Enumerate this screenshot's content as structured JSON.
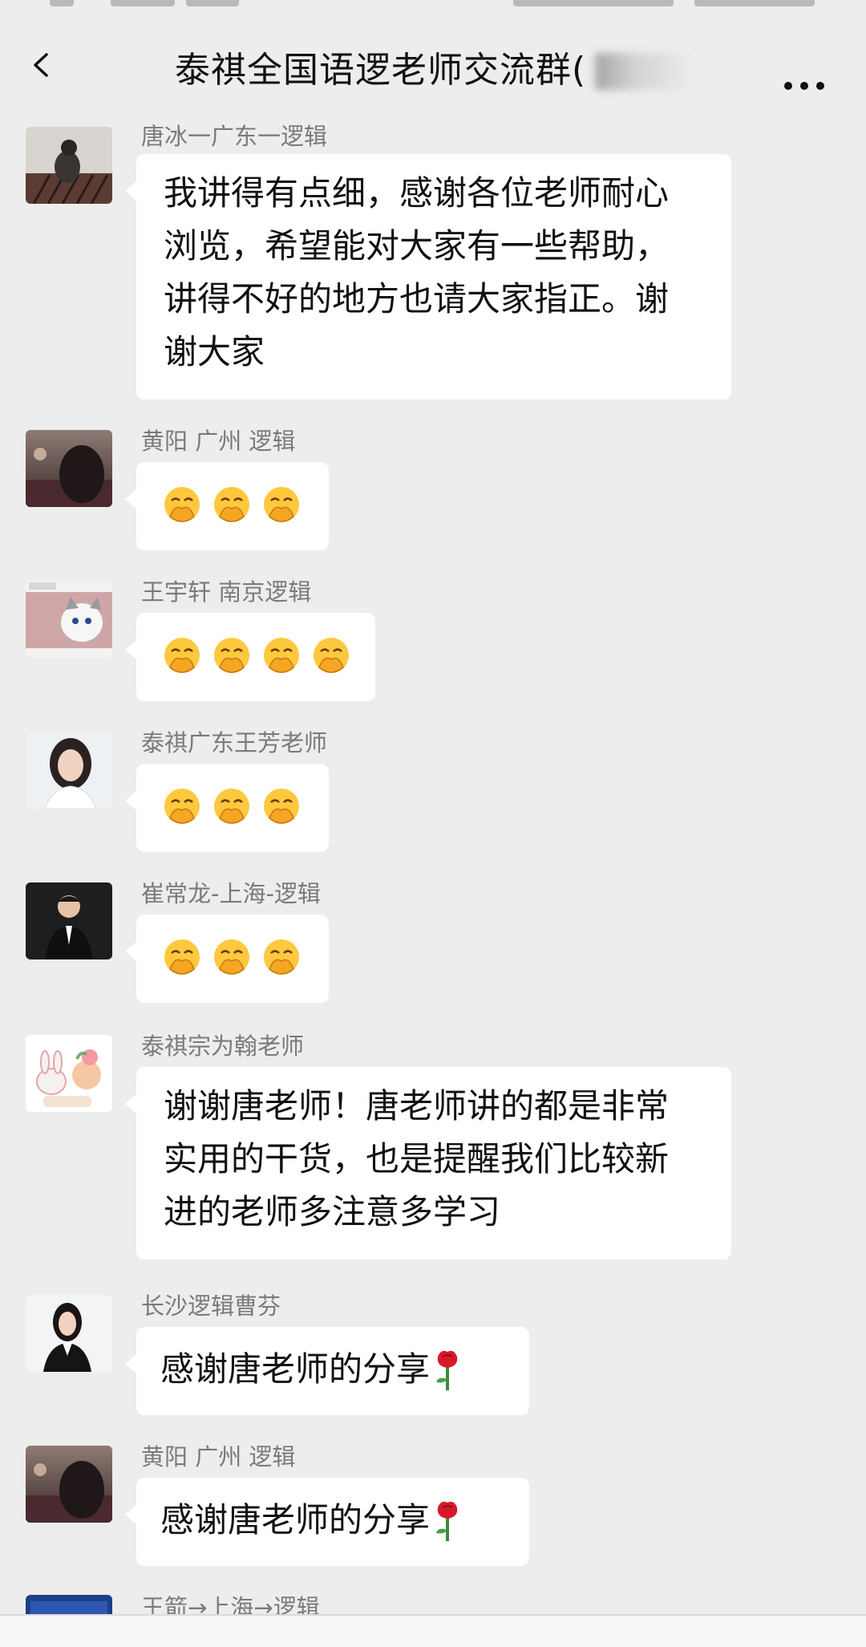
{
  "header": {
    "title": "泰祺全国语逻老师交流群(",
    "back_icon": "chevron-left-icon",
    "more_icon": "more-dots-icon"
  },
  "messages": [
    {
      "sender": "唐冰一广东一逻辑",
      "lines": [
        "我讲得有点细，感谢各位老师耐心",
        "浏览，希望能对大家有一些帮助，",
        "讲得不好的地方也请大家指正。谢",
        "谢大家"
      ]
    },
    {
      "sender": "黄阳 广州 逻辑",
      "emoji_count": 3,
      "emoji": "hand-over-mouth-emoji"
    },
    {
      "sender": "王宇轩 南京逻辑",
      "emoji_count": 4,
      "emoji": "hand-over-mouth-emoji"
    },
    {
      "sender": "泰祺广东王芳老师",
      "emoji_count": 3,
      "emoji": "hand-over-mouth-emoji"
    },
    {
      "sender": "崔常龙-上海-逻辑",
      "emoji_count": 3,
      "emoji": "hand-over-mouth-emoji"
    },
    {
      "sender": "泰祺宗为翰老师",
      "lines": [
        "谢谢唐老师！唐老师讲的都是非常",
        "实用的干货，也是提醒我们比较新",
        "进的老师多注意多学习"
      ]
    },
    {
      "sender": "长沙逻辑曹芬",
      "text": "感谢唐老师的分享",
      "trailing_icon": "rose-icon"
    },
    {
      "sender": "黄阳 广州 逻辑",
      "text": "感谢唐老师的分享",
      "trailing_icon": "rose-icon"
    },
    {
      "sender": "王箭→上海→逻辑"
    }
  ],
  "colors": {
    "background": "#ededed",
    "bubble": "#ffffff",
    "sender": "#7a7a7a",
    "text": "#111111"
  }
}
